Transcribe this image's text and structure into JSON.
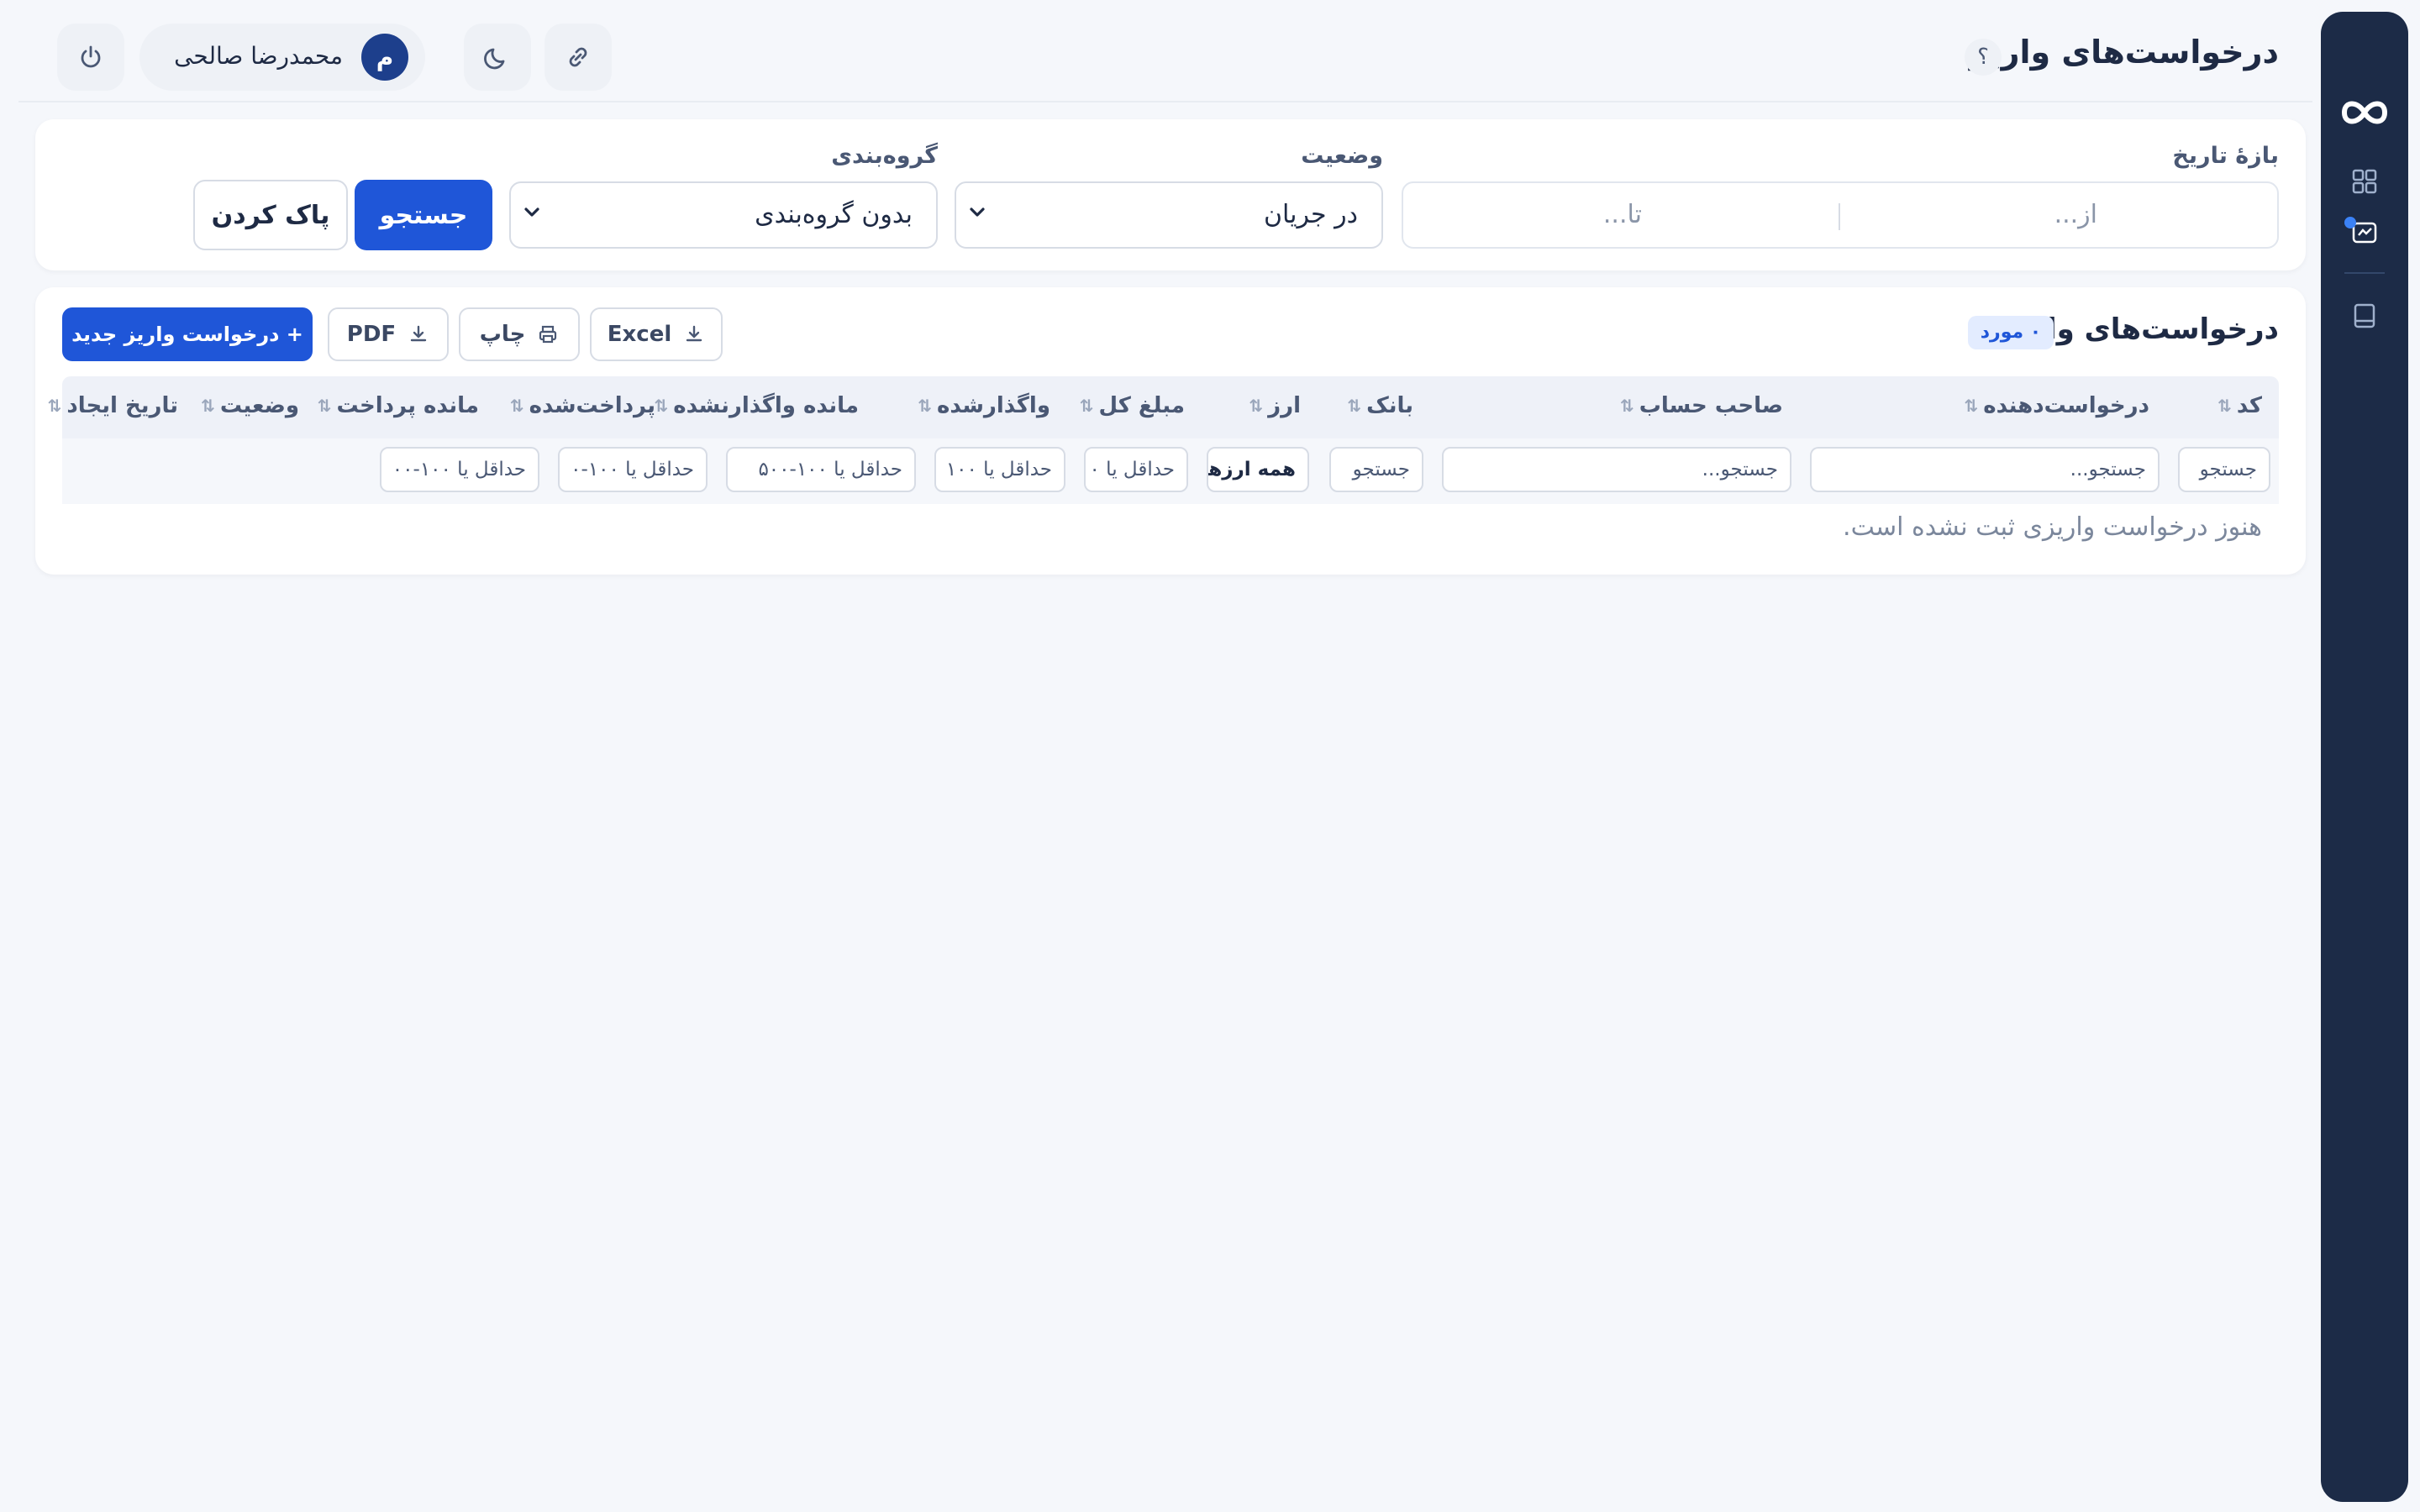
{
  "header": {
    "title": "درخواست‌های واریز",
    "help": "؟",
    "user_name": "محمدرضا صالحی",
    "avatar_letter": "م"
  },
  "filters": {
    "date_label": "بازهٔ تاریخ",
    "date_from_placeholder": "از...",
    "date_to_placeholder": "تا...",
    "status_label": "وضعیت",
    "status_value": "در جریان",
    "group_label": "گروه‌بندی",
    "group_value": "بدون گروه‌بندی",
    "search_button": "جستجو",
    "clear_button": "پاک کردن"
  },
  "list": {
    "title": "درخواست‌های واریز",
    "count_badge": "۰ مورد",
    "new_button": "+ درخواست واریز جدید",
    "pdf_button": "PDF",
    "print_button": "چاپ",
    "excel_button": "Excel",
    "columns": {
      "code": "کد",
      "requester": "درخواست‌دهنده",
      "account_holder": "صاحب حساب",
      "bank": "بانک",
      "currency": "ارز",
      "total_amount": "مبلغ کل",
      "assigned": "واگذارشده",
      "unassigned_remaining": "مانده واگذارنشده",
      "paid": "پرداخت‌شده",
      "payment_remaining": "مانده پرداخت",
      "status": "وضعیت",
      "created_at": "تاریخ ایجاد"
    },
    "column_filters": {
      "code": "جستجو",
      "requester": "جستجو...",
      "account_holder": "جستجو...",
      "bank": "جستجو",
      "currency": "همه ارزها",
      "total_amount": "حداقل یا ۰",
      "assigned": "حداقل یا ۱۰۰",
      "unassigned_remaining": "حداقل یا ۱۰۰-۵۰۰",
      "paid": "حداقل یا ۱۰۰-۰",
      "payment_remaining": "حداقل یا ۱۰۰-۰۰"
    },
    "empty_message": "هنوز درخواست واریزی ثبت نشده است."
  },
  "colors": {
    "primary": "#1f56d8",
    "sidebar": "#1c2b47",
    "background": "#f5f7fb"
  },
  "icons": [
    "logo-icon",
    "dashboard-icon",
    "deposit-icon",
    "book-icon",
    "help-icon",
    "power-icon",
    "moon-icon",
    "link-icon",
    "download-icon",
    "printer-icon",
    "sort-icon",
    "chevron-down-icon"
  ]
}
